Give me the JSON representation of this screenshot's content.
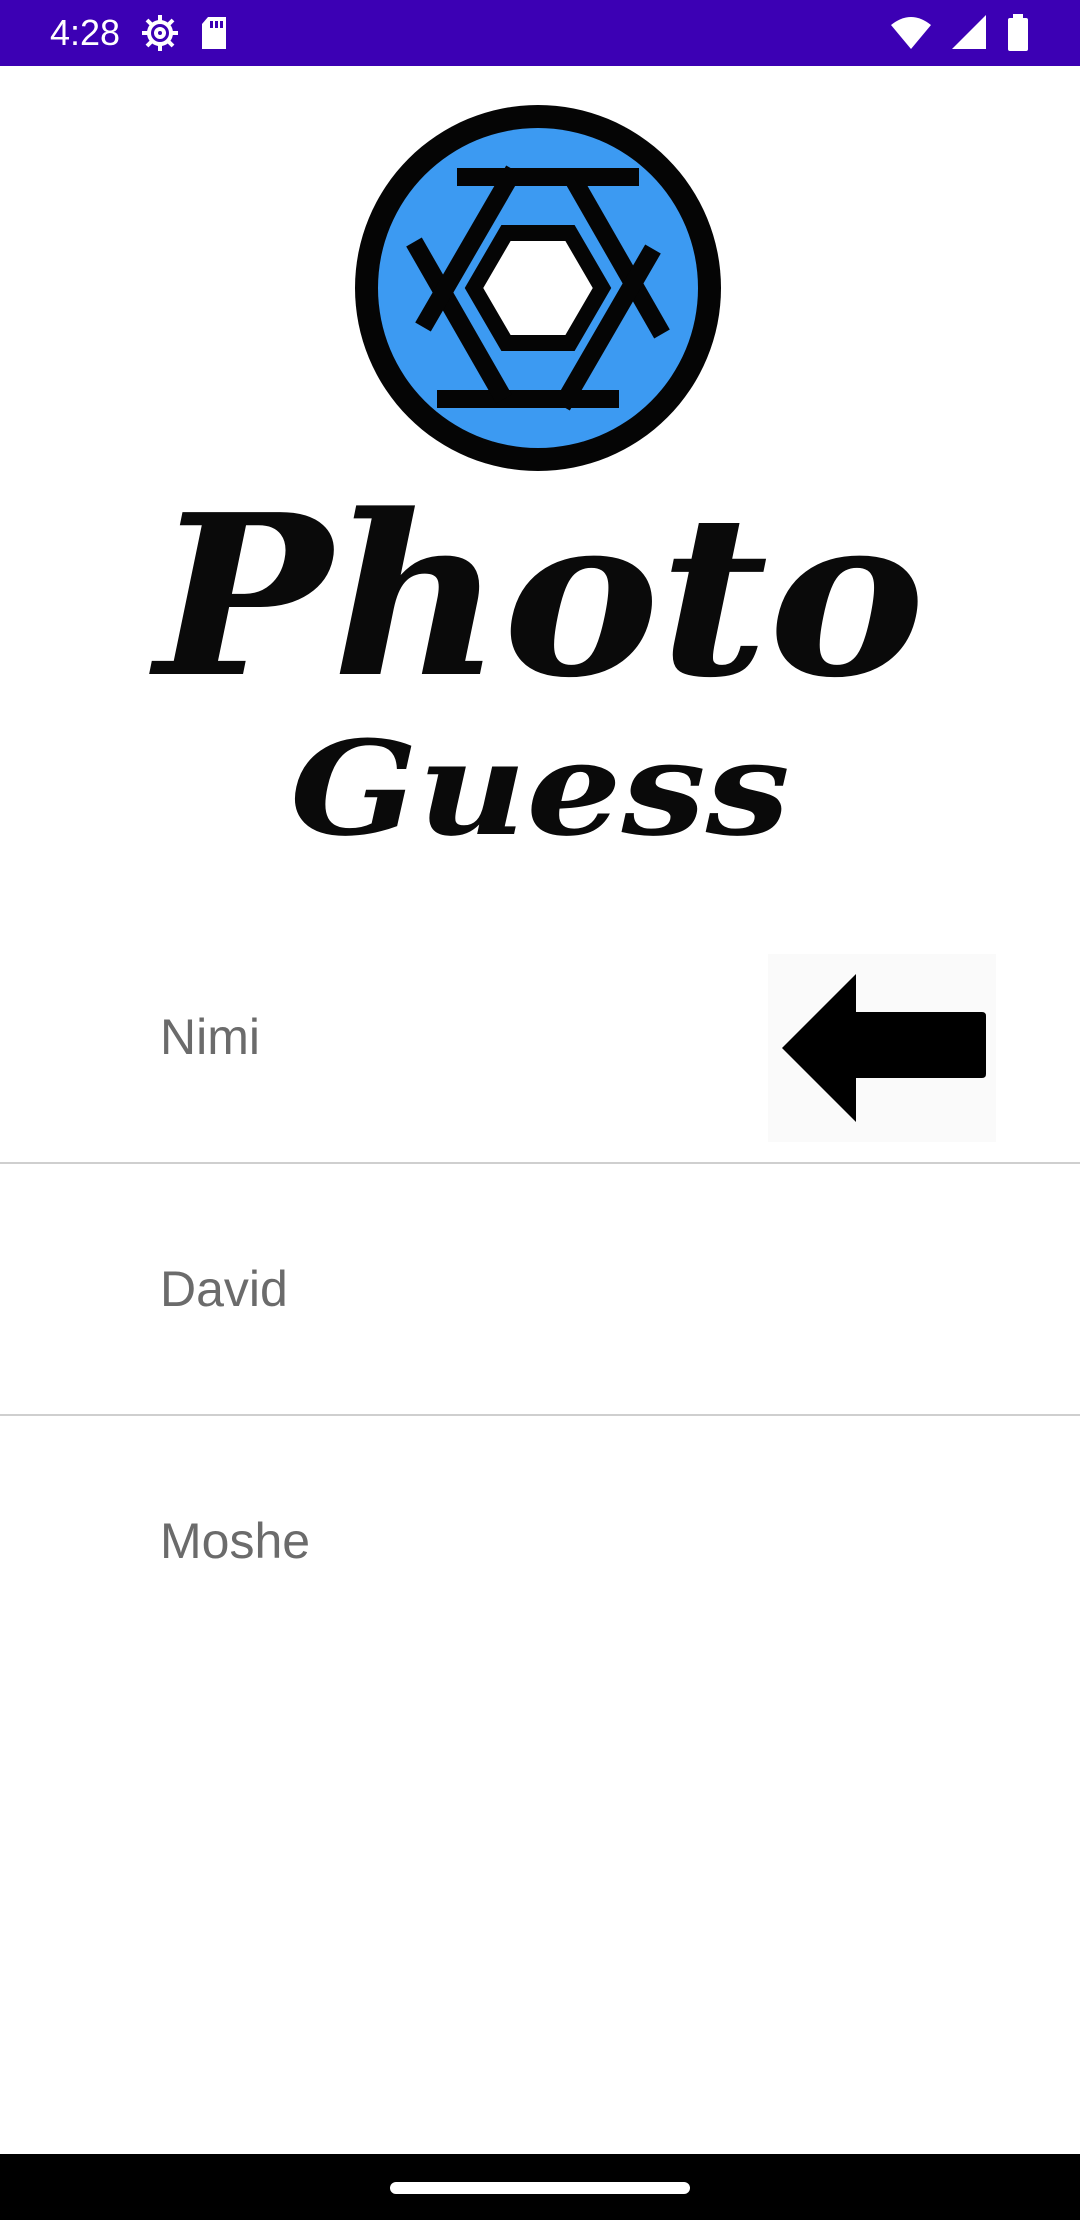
{
  "status_bar": {
    "time": "4:28",
    "background": "#3c00b4",
    "left_icons": [
      "settings-icon",
      "sd-card-icon"
    ],
    "right_icons": [
      "wifi-icon",
      "signal-icon",
      "battery-icon"
    ]
  },
  "logo": {
    "line1": "Photo",
    "line2": "Guess",
    "aperture_color": "#3c9af2",
    "ring_color": "#050505",
    "icon": "camera-aperture-icon"
  },
  "players": [
    {
      "name": "Nimi",
      "current_turn": true,
      "indicator_icon": "arrow-left-icon"
    },
    {
      "name": "David",
      "current_turn": false
    },
    {
      "name": "Moshe",
      "current_turn": false
    }
  ],
  "nav_bar": {
    "background": "#000000",
    "handle": "gesture-handle"
  }
}
